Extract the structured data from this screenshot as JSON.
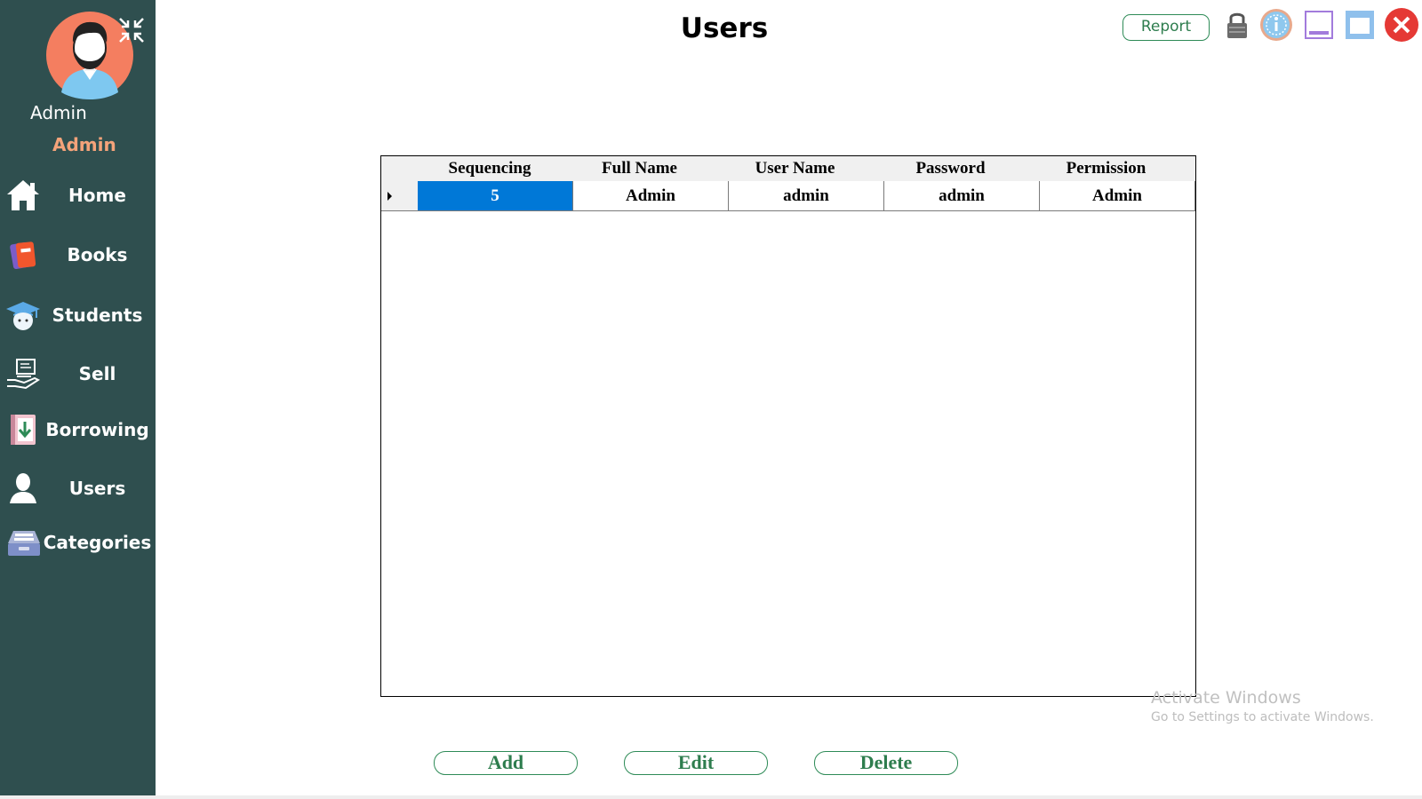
{
  "sidebar": {
    "user_role": "Admin",
    "user_name": "Admin",
    "items": [
      {
        "label": "Home",
        "icon": "home-icon"
      },
      {
        "label": "Books",
        "icon": "books-icon"
      },
      {
        "label": "Students",
        "icon": "student-icon"
      },
      {
        "label": "Sell",
        "icon": "sell-icon"
      },
      {
        "label": "Borrowing",
        "icon": "borrowing-icon"
      },
      {
        "label": "Users",
        "icon": "user-icon"
      },
      {
        "label": "Categories",
        "icon": "categories-icon"
      }
    ]
  },
  "header": {
    "title": "Users",
    "report_label": "Report"
  },
  "table": {
    "columns": [
      "Sequencing",
      "Full Name",
      "User Name",
      "Password",
      "Permission"
    ],
    "rows": [
      [
        "5",
        "Admin",
        "admin",
        "admin",
        "Admin"
      ]
    ]
  },
  "watermark": {
    "title": "Activate Windows",
    "subtitle": "Go to Settings to activate Windows."
  },
  "actions": {
    "add_label": "Add",
    "edit_label": "Edit",
    "delete_label": "Delete"
  },
  "colors": {
    "sidebar_bg": "#2f4f4f",
    "accent_green": "#2e8b57",
    "selection_blue": "#0078d7",
    "close_red": "#e53935"
  }
}
